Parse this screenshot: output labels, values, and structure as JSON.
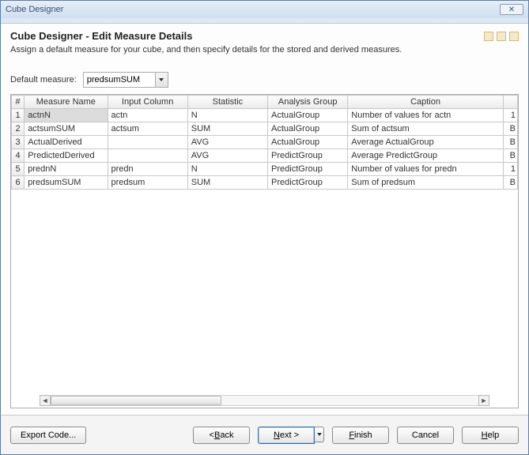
{
  "titlebar": {
    "title": "Cube Designer",
    "close_label": "✕"
  },
  "page": {
    "title": "Cube Designer - Edit Measure Details",
    "subtitle": "Assign a default measure for your cube, and then specify details for the stored and derived measures."
  },
  "default_measure": {
    "label": "Default measure:",
    "value": "predsumSUM"
  },
  "columns": {
    "num": "#",
    "name": "Measure Name",
    "input": "Input Column",
    "stat": "Statistic",
    "ag": "Analysis Group",
    "cap": "Caption"
  },
  "rows": [
    {
      "n": "1",
      "name": "actnN",
      "input": "actn",
      "stat": "N",
      "ag": "ActualGroup",
      "cap": "Number of values for actn",
      "tail": "1"
    },
    {
      "n": "2",
      "name": "actsumSUM",
      "input": "actsum",
      "stat": "SUM",
      "ag": "ActualGroup",
      "cap": "Sum of actsum",
      "tail": "B"
    },
    {
      "n": "3",
      "name": "ActualDerived",
      "input": "",
      "stat": "AVG",
      "ag": "ActualGroup",
      "cap": "Average ActualGroup",
      "tail": "B"
    },
    {
      "n": "4",
      "name": "PredictedDerived",
      "input": "",
      "stat": "AVG",
      "ag": "PredictGroup",
      "cap": "Average PredictGroup",
      "tail": "B"
    },
    {
      "n": "5",
      "name": "prednN",
      "input": "predn",
      "stat": "N",
      "ag": "PredictGroup",
      "cap": "Number of values for predn",
      "tail": "1"
    },
    {
      "n": "6",
      "name": "predsumSUM",
      "input": "predsum",
      "stat": "SUM",
      "ag": "PredictGroup",
      "cap": "Sum of predsum",
      "tail": "B"
    }
  ],
  "footer": {
    "export": "Export Code...",
    "back_u": "B",
    "back_rest": "ack",
    "next_u": "N",
    "next_rest": "ext >",
    "finish_u": "F",
    "finish_rest": "inish",
    "cancel": "Cancel",
    "help_u": "H",
    "help_rest": "elp"
  }
}
